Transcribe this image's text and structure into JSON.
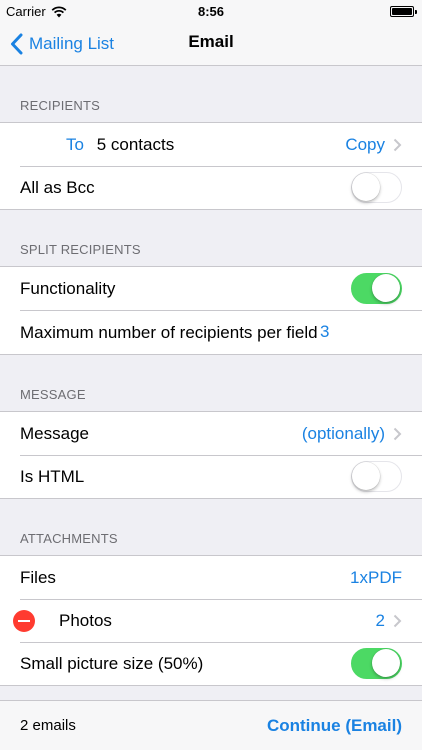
{
  "status": {
    "carrier": "Carrier",
    "time": "8:56",
    "battery_level": 1.0
  },
  "nav": {
    "back_label": "Mailing List",
    "title": "Email"
  },
  "sections": {
    "recipients": {
      "header": "RECIPIENTS",
      "to_label": "To",
      "to_value": "5 contacts",
      "copy_label": "Copy",
      "bcc_label": "All as Bcc",
      "bcc_on": false
    },
    "split": {
      "header": "SPLIT RECIPIENTS",
      "functionality_label": "Functionality",
      "functionality_on": true,
      "max_label": "Maximum number of recipients per field",
      "max_value": "3"
    },
    "message": {
      "header": "MESSAGE",
      "message_label": "Message",
      "message_value": "(optionally)",
      "html_label": "Is HTML",
      "html_on": false
    },
    "attachments": {
      "header": "ATTACHMENTS",
      "files_label": "Files",
      "files_value": "1xPDF",
      "photos_label": "Photos",
      "photos_value": "2",
      "small_label": "Small picture size (50%)",
      "small_on": true
    }
  },
  "toolbar": {
    "count": "2 emails",
    "continue_label": "Continue (Email)"
  },
  "colors": {
    "accent": "#1a82e2",
    "switch_on": "#4cd964",
    "delete": "#ff3b30"
  }
}
